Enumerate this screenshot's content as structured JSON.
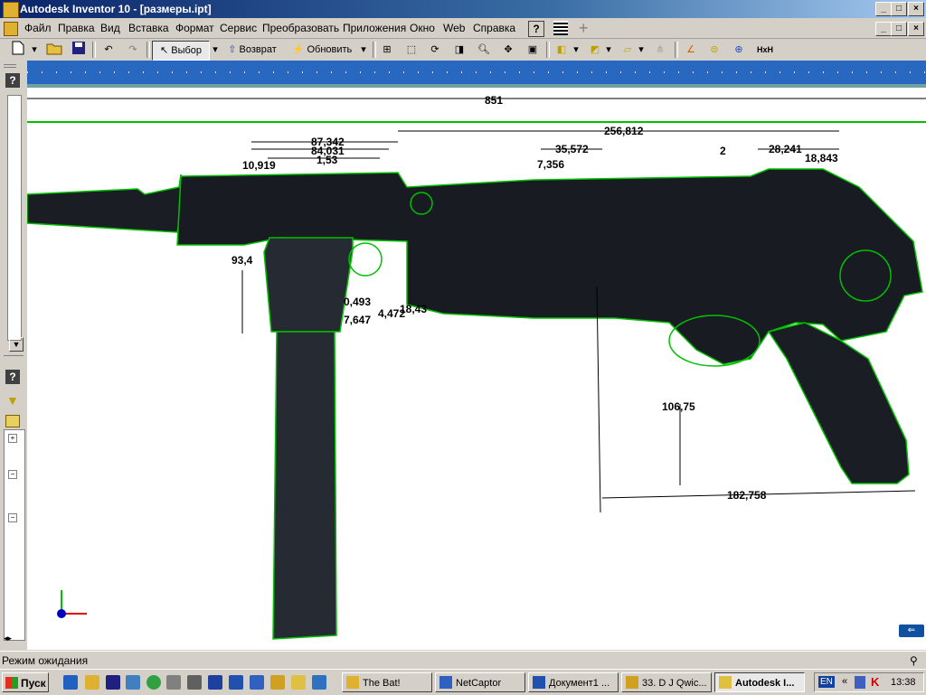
{
  "window": {
    "title": "Autodesk Inventor 10 - [размеры.ipt]",
    "min": "_",
    "max": "□",
    "close": "×"
  },
  "menu": [
    "Файл",
    "Правка",
    "Вид",
    "Вставка",
    "Формат",
    "Сервис",
    "Преобразовать",
    "Приложения",
    "Окно",
    "Web",
    "Справка"
  ],
  "toolbar": {
    "select_label": "Выбор",
    "return_label": "Возврат",
    "update_label": "Обновить",
    "hxh_label": "HxH"
  },
  "dimensions": {
    "d851": "851",
    "d256": "256,812",
    "d87": "87,342",
    "d84": "84,031",
    "d153": "1,53",
    "d10": "10,919",
    "d35": "35,572",
    "d7": "7,356",
    "d2": "2",
    "d28": "28,241",
    "d18": "18,843",
    "d93": "93,4",
    "d0493": "0,493",
    "d7647": "7,647",
    "d4472": "4,472",
    "d1843": "18,43",
    "d106": "106,75",
    "d182": "182,758"
  },
  "status": {
    "text": "Режим ожидания"
  },
  "taskbar": {
    "start": "Пуск",
    "tasks": [
      "The Bat!",
      "NetCaptor",
      "Документ1 ...",
      "33. D J Qwic...",
      "Autodesk I..."
    ],
    "lang": "EN",
    "clock": "13:38"
  }
}
